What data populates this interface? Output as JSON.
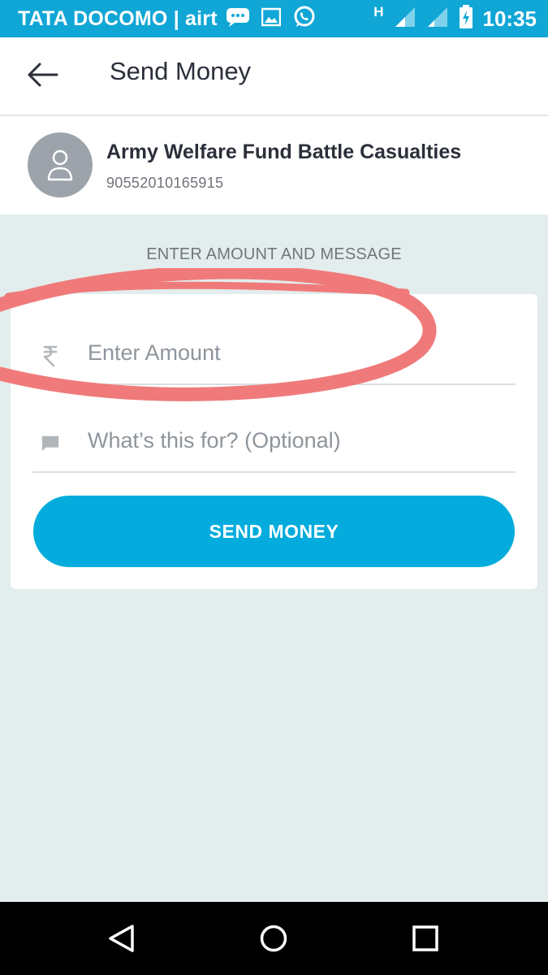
{
  "status_bar": {
    "carrier": "TATA DOCOMO | airt",
    "network_type": "H",
    "time": "10:35",
    "icons": [
      "message-icon",
      "gallery-icon",
      "whatsapp-icon",
      "signal-icon",
      "signal-icon",
      "battery-charging-icon"
    ]
  },
  "app_bar": {
    "back_icon": "arrow-left-icon",
    "title": "Send Money"
  },
  "payee": {
    "avatar_icon": "person-icon",
    "name": "Army Welfare Fund Battle Casualties",
    "account": "90552010165915"
  },
  "form": {
    "section_label": "ENTER AMOUNT AND MESSAGE",
    "amount": {
      "icon": "rupee-icon",
      "value": "",
      "placeholder": "Enter Amount"
    },
    "message": {
      "icon": "chat-bubble-icon",
      "value": "",
      "placeholder": "What’s this for? (Optional)"
    },
    "send_label": "SEND MONEY"
  },
  "nav_bar": {
    "icons": [
      "back-triangle-icon",
      "home-circle-icon",
      "recents-square-icon"
    ]
  },
  "colors": {
    "status_bar": "#10a6d6",
    "accent": "#03acdc",
    "background": "#e3eded",
    "annotation": "#f07a7a"
  }
}
